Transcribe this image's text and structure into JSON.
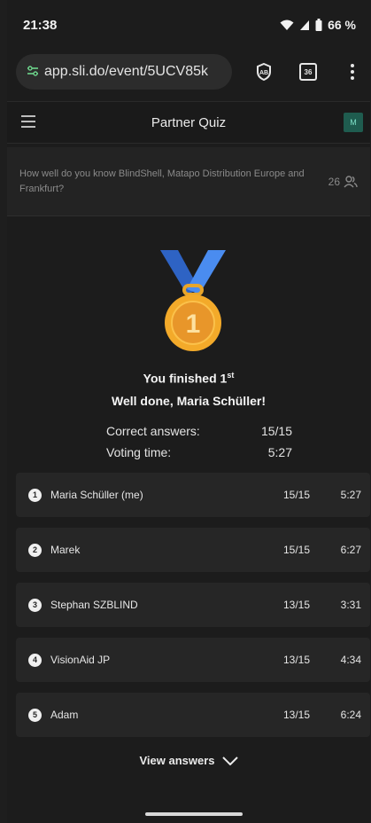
{
  "status_bar": {
    "time": "21:38",
    "battery": "66 %"
  },
  "browser": {
    "url": "app.sli.do/event/5UCV85k",
    "tab_count": "36"
  },
  "app_bar": {
    "title": "Partner Quiz",
    "avatar_initial": "M"
  },
  "question": {
    "text": "How well do you know BlindShell, Matapo Distribution Europe and Frankfurt?",
    "participants": "26"
  },
  "result": {
    "finished_prefix": "You finished 1",
    "finished_suffix": "st",
    "well_done": "Well done, Maria Schüller!",
    "correct_label": "Correct answers:",
    "correct_value": "15/15",
    "time_label": "Voting time:",
    "time_value": "5:27"
  },
  "leaderboard": [
    {
      "rank": "1",
      "name": "Maria Schüller (me)",
      "score": "15/15",
      "time": "5:27"
    },
    {
      "rank": "2",
      "name": "Marek",
      "score": "15/15",
      "time": "6:27"
    },
    {
      "rank": "3",
      "name": "Stephan SZBLIND",
      "score": "13/15",
      "time": "3:31"
    },
    {
      "rank": "4",
      "name": "VisionAid JP",
      "score": "13/15",
      "time": "4:34"
    },
    {
      "rank": "5",
      "name": "Adam",
      "score": "13/15",
      "time": "6:24"
    }
  ],
  "view_answers_label": "View answers",
  "medal": {
    "number": "1",
    "ribbon_color": "#3a7be0",
    "medal_color": "#f0a928"
  }
}
